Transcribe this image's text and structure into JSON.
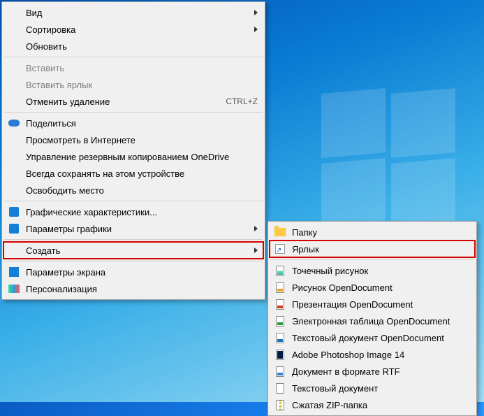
{
  "mainMenu": {
    "groups": [
      [
        {
          "id": "view",
          "label": "Вид",
          "icon": "",
          "arrow": true,
          "disabled": false
        },
        {
          "id": "sort",
          "label": "Сортировка",
          "icon": "",
          "arrow": true,
          "disabled": false
        },
        {
          "id": "refresh",
          "label": "Обновить",
          "icon": "",
          "arrow": false,
          "disabled": false
        }
      ],
      [
        {
          "id": "paste",
          "label": "Вставить",
          "icon": "",
          "arrow": false,
          "disabled": true
        },
        {
          "id": "paste-shortcut",
          "label": "Вставить ярлык",
          "icon": "",
          "arrow": false,
          "disabled": true
        },
        {
          "id": "undo-delete",
          "label": "Отменить удаление",
          "icon": "",
          "arrow": false,
          "disabled": false,
          "shortcut": "CTRL+Z"
        }
      ],
      [
        {
          "id": "share",
          "label": "Поделиться",
          "icon": "onedrive",
          "arrow": false,
          "disabled": false
        },
        {
          "id": "view-online",
          "label": "Просмотреть в Интернете",
          "icon": "",
          "arrow": false,
          "disabled": false
        },
        {
          "id": "onedrive-backup",
          "label": "Управление резервным копированием OneDrive",
          "icon": "",
          "arrow": false,
          "disabled": false
        },
        {
          "id": "always-save",
          "label": "Всегда сохранять на этом устройстве",
          "icon": "",
          "arrow": false,
          "disabled": false
        },
        {
          "id": "free-space",
          "label": "Освободить место",
          "icon": "",
          "arrow": false,
          "disabled": false
        }
      ],
      [
        {
          "id": "gfx-props",
          "label": "Графические характеристики...",
          "icon": "intel",
          "arrow": false,
          "disabled": false
        },
        {
          "id": "gfx-params",
          "label": "Параметры графики",
          "icon": "intel",
          "arrow": true,
          "disabled": false
        }
      ],
      [
        {
          "id": "create",
          "label": "Создать",
          "icon": "",
          "arrow": true,
          "disabled": false,
          "highlight": true
        }
      ],
      [
        {
          "id": "display-settings",
          "label": "Параметры экрана",
          "icon": "settings",
          "arrow": false,
          "disabled": false
        },
        {
          "id": "personalize",
          "label": "Персонализация",
          "icon": "personalize",
          "arrow": false,
          "disabled": false
        }
      ]
    ]
  },
  "subMenu": {
    "groups": [
      [
        {
          "id": "folder",
          "label": "Папку",
          "icon": "folder"
        },
        {
          "id": "shortcut",
          "label": "Ярлык",
          "icon": "shortcut",
          "highlight": true
        }
      ],
      [
        {
          "id": "bmp",
          "label": "Точечный рисунок",
          "icon": "file-bmp"
        },
        {
          "id": "odg",
          "label": "Рисунок OpenDocument",
          "icon": "file-odg"
        },
        {
          "id": "odp",
          "label": "Презентация OpenDocument",
          "icon": "file-odp"
        },
        {
          "id": "ods",
          "label": "Электронная таблица OpenDocument",
          "icon": "file-ods"
        },
        {
          "id": "odt",
          "label": "Текстовый документ OpenDocument",
          "icon": "file-odt"
        },
        {
          "id": "psd",
          "label": "Adobe Photoshop Image 14",
          "icon": "file-psd"
        },
        {
          "id": "rtf",
          "label": "Документ в формате RTF",
          "icon": "file-rtf"
        },
        {
          "id": "txt",
          "label": "Текстовый документ",
          "icon": "file-txt"
        },
        {
          "id": "zip",
          "label": "Сжатая ZIP-папка",
          "icon": "file-zip"
        }
      ]
    ]
  }
}
